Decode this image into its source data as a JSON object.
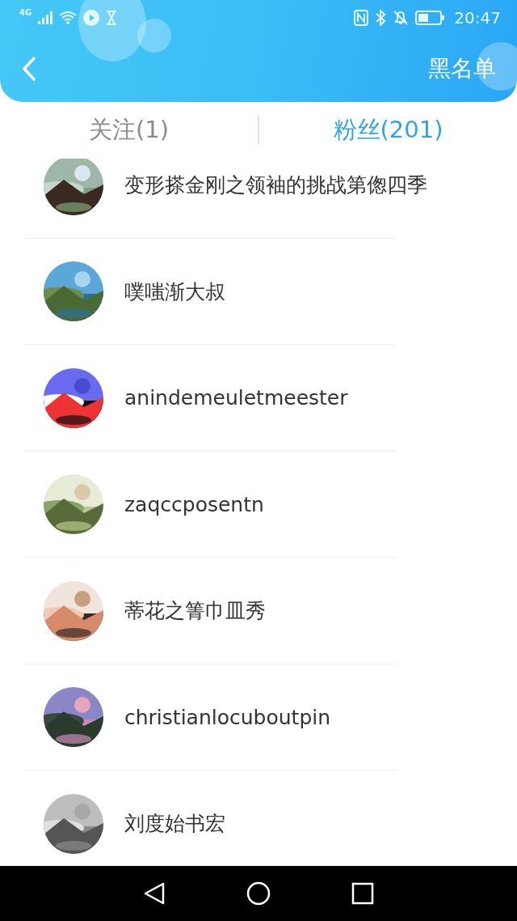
{
  "status_bar": {
    "network": "4G",
    "time": "20:47"
  },
  "header": {
    "action": "黑名单"
  },
  "tabs": [
    {
      "label": "关注(1)",
      "selected": false
    },
    {
      "label": "粉丝(201)",
      "selected": true
    }
  ],
  "fans": [
    {
      "name": "变形搽金刚之领袖的挑战第偬四季"
    },
    {
      "name": "噗嗤渐大叔"
    },
    {
      "name": "anindemeuletmeester"
    },
    {
      "name": "zaqccposentn"
    },
    {
      "name": "蒂花之箐巾皿秀"
    },
    {
      "name": "christianlocuboutpin"
    },
    {
      "name": "刘度始书宏"
    }
  ]
}
